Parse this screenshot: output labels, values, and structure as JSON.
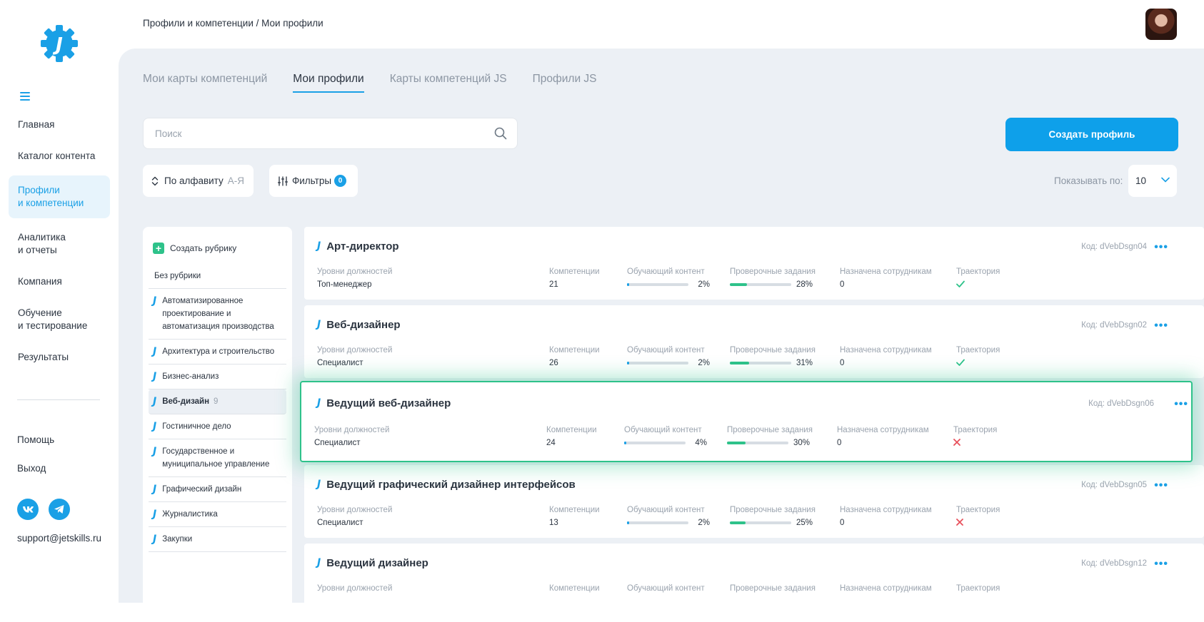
{
  "sidebar": {
    "nav": [
      {
        "label": "Главная",
        "active": false
      },
      {
        "label": "Каталог контента",
        "active": false
      },
      {
        "label": "Профили\nи компетенции",
        "active": true
      },
      {
        "label": "Аналитика\nи отчеты",
        "active": false
      },
      {
        "label": "Компания",
        "active": false
      },
      {
        "label": "Обучение\nи тестирование",
        "active": false
      },
      {
        "label": "Результаты",
        "active": false
      }
    ],
    "bottom": {
      "help": "Помощь",
      "logout": "Выход"
    },
    "support_email": "support@jetskills.ru",
    "accent": "#1aa0e6"
  },
  "header": {
    "breadcrumb": "Профили и компетенции / Мои профили"
  },
  "tabs": [
    {
      "label": "Мои карты компетенций",
      "active": false
    },
    {
      "label": "Мои профили",
      "active": true
    },
    {
      "label": "Карты компетенций JS",
      "active": false
    },
    {
      "label": "Профили JS",
      "active": false
    }
  ],
  "search": {
    "placeholder": "Поиск",
    "value": ""
  },
  "create_button": "Создать профиль",
  "sort": {
    "label": "По алфавиту",
    "order": "А-Я"
  },
  "filters": {
    "label": "Фильтры",
    "count": "0"
  },
  "page_size": {
    "label": "Показывать по:",
    "value": "10"
  },
  "rubrics": {
    "create_label": "Создать рубрику",
    "no_rubric": "Без рубрики",
    "items": [
      {
        "label": "Автоматизированное проектирование и автоматизация производства",
        "count": ""
      },
      {
        "label": "Архитектура и строительство",
        "count": ""
      },
      {
        "label": "Бизнес-анализ",
        "count": ""
      },
      {
        "label": "Веб-дизайн",
        "count": "9",
        "active": true
      },
      {
        "label": "Гостиничное дело",
        "count": ""
      },
      {
        "label": "Государственное и муниципальное управление",
        "count": ""
      },
      {
        "label": "Графический дизайн",
        "count": ""
      },
      {
        "label": "Журналистика",
        "count": ""
      },
      {
        "label": "Закупки",
        "count": ""
      }
    ]
  },
  "columns": {
    "levels": "Уровни должностей",
    "competencies": "Компетенции",
    "content": "Обучающий контент",
    "tasks": "Проверочные задания",
    "assigned": "Назначена сотрудникам",
    "trajectory": "Траектория"
  },
  "code_prefix": "Код:",
  "profiles": [
    {
      "title": "Арт-директор",
      "code": "dVebDsgn04",
      "level": "Топ-менеджер",
      "competencies": "21",
      "content_pct": 2,
      "content_label": "2%",
      "tasks_pct": 28,
      "tasks_label": "28%",
      "assigned": "0",
      "trajectory": true
    },
    {
      "title": "Веб-дизайнер",
      "code": "dVebDsgn02",
      "level": "Специалист",
      "competencies": "26",
      "content_pct": 2,
      "content_label": "2%",
      "tasks_pct": 31,
      "tasks_label": "31%",
      "assigned": "0",
      "trajectory": true
    },
    {
      "title": "Ведущий веб-дизайнер",
      "code": "dVebDsgn06",
      "level": "Специалист",
      "competencies": "24",
      "content_pct": 4,
      "content_label": "4%",
      "tasks_pct": 30,
      "tasks_label": "30%",
      "assigned": "0",
      "trajectory": false,
      "highlighted": true
    },
    {
      "title": "Ведущий графический дизайнер интерфейсов",
      "code": "dVebDsgn05",
      "level": "Специалист",
      "competencies": "13",
      "content_pct": 2,
      "content_label": "2%",
      "tasks_pct": 25,
      "tasks_label": "25%",
      "assigned": "0",
      "trajectory": false
    },
    {
      "title": "Ведущий дизайнер",
      "code": "dVebDsgn12",
      "level": "",
      "competencies": "",
      "content_pct": null,
      "content_label": "",
      "tasks_pct": null,
      "tasks_label": "",
      "assigned": "",
      "trajectory": null
    }
  ]
}
